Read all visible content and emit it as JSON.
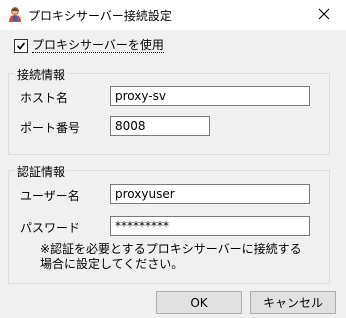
{
  "window": {
    "title": "プロキシサーバー接続設定",
    "app_icon": "user-app-icon",
    "close_icon": "close-icon"
  },
  "proxy_checkbox": {
    "label": "プロキシサーバーを使用",
    "checked": true
  },
  "connection_group": {
    "title": "接続情報",
    "host_label": "ホスト名",
    "host_value": "proxy-sv",
    "port_label": "ポート番号",
    "port_value": "8008"
  },
  "auth_group": {
    "title": "認証情報",
    "user_label": "ユーザー名",
    "user_value": "proxyuser",
    "password_label": "パスワード",
    "password_value": "*********",
    "note_line1": "※認証を必要とするプロキシサーバーに接続する",
    "note_line2": "場合に設定してください。"
  },
  "buttons": {
    "ok": "OK",
    "cancel": "キャンセル"
  }
}
